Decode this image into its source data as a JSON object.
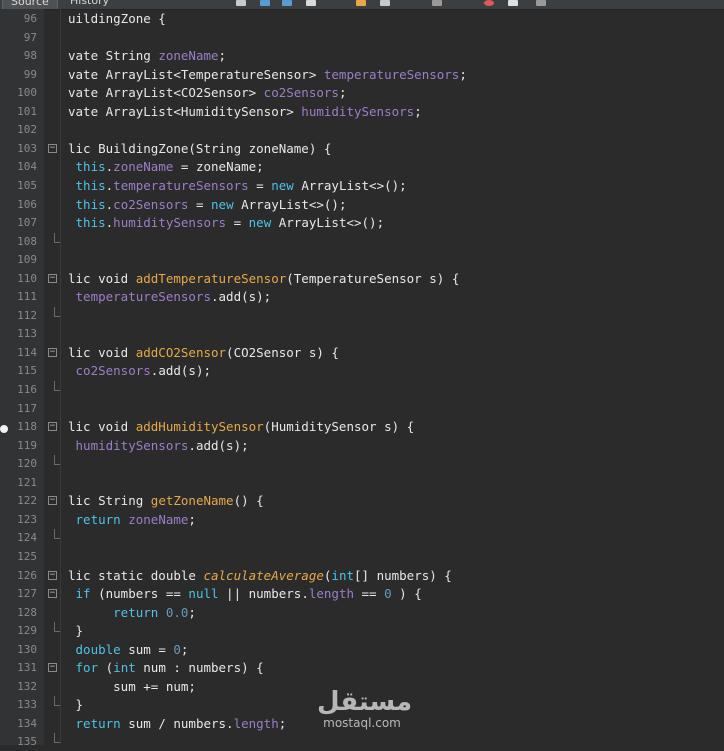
{
  "tabs": [
    {
      "label": "Source"
    },
    {
      "label": "History"
    }
  ],
  "toolbar_icons": [
    "search-icon",
    "back-icon",
    "forward-icon",
    "file-icon",
    "breakpoint-icon",
    "warning-icon",
    "comment-icon",
    "record-icon",
    "stop-icon"
  ],
  "lines": [
    {
      "n": "96",
      "fold": "",
      "segs": [
        [
          "",
          "uildingZone {"
        ]
      ]
    },
    {
      "n": "97",
      "fold": "",
      "segs": []
    },
    {
      "n": "98",
      "fold": "",
      "segs": [
        [
          "",
          "vate String "
        ],
        [
          "field",
          "zoneName"
        ],
        [
          "",
          ";"
        ]
      ]
    },
    {
      "n": "99",
      "fold": "",
      "segs": [
        [
          "",
          "vate ArrayList<TemperatureSensor> "
        ],
        [
          "field",
          "temperatureSensors"
        ],
        [
          "",
          ";"
        ]
      ]
    },
    {
      "n": "100",
      "fold": "",
      "segs": [
        [
          "",
          "vate ArrayList<CO2Sensor> "
        ],
        [
          "field",
          "co2Sensors"
        ],
        [
          "",
          ";"
        ]
      ]
    },
    {
      "n": "101",
      "fold": "",
      "segs": [
        [
          "",
          "vate ArrayList<HumiditySensor> "
        ],
        [
          "field",
          "humiditySensors"
        ],
        [
          "",
          ";"
        ]
      ]
    },
    {
      "n": "102",
      "fold": "",
      "segs": []
    },
    {
      "n": "103",
      "fold": "box",
      "segs": [
        [
          "",
          "lic BuildingZone(String zoneName) {"
        ]
      ]
    },
    {
      "n": "104",
      "fold": "",
      "segs": [
        [
          "kw",
          " this"
        ],
        [
          "",
          "."
        ],
        [
          "field",
          "zoneName"
        ],
        [
          "",
          " = zoneName;"
        ]
      ]
    },
    {
      "n": "105",
      "fold": "",
      "segs": [
        [
          "kw",
          " this"
        ],
        [
          "",
          "."
        ],
        [
          "field",
          "temperatureSensors"
        ],
        [
          "",
          " = "
        ],
        [
          "kw",
          "new"
        ],
        [
          "",
          " ArrayList<>();"
        ]
      ]
    },
    {
      "n": "106",
      "fold": "",
      "segs": [
        [
          "kw",
          " this"
        ],
        [
          "",
          "."
        ],
        [
          "field",
          "co2Sensors"
        ],
        [
          "",
          " = "
        ],
        [
          "kw",
          "new"
        ],
        [
          "",
          " ArrayList<>();"
        ]
      ]
    },
    {
      "n": "107",
      "fold": "",
      "segs": [
        [
          "kw",
          " this"
        ],
        [
          "",
          "."
        ],
        [
          "field",
          "humiditySensors"
        ],
        [
          "",
          " = "
        ],
        [
          "kw",
          "new"
        ],
        [
          "",
          " ArrayList<>();"
        ]
      ]
    },
    {
      "n": "108",
      "fold": "end",
      "segs": []
    },
    {
      "n": "109",
      "fold": "",
      "segs": []
    },
    {
      "n": "110",
      "fold": "box",
      "segs": [
        [
          "",
          "lic void "
        ],
        [
          "meth",
          "addTemperatureSensor"
        ],
        [
          "",
          "(TemperatureSensor s) {"
        ]
      ]
    },
    {
      "n": "111",
      "fold": "",
      "segs": [
        [
          "field",
          " temperatureSensors"
        ],
        [
          "",
          ".add(s);"
        ]
      ]
    },
    {
      "n": "112",
      "fold": "end",
      "segs": []
    },
    {
      "n": "113",
      "fold": "",
      "segs": []
    },
    {
      "n": "114",
      "fold": "box",
      "segs": [
        [
          "",
          "lic void "
        ],
        [
          "meth",
          "addCO2Sensor"
        ],
        [
          "",
          "(CO2Sensor s) {"
        ]
      ]
    },
    {
      "n": "115",
      "fold": "",
      "segs": [
        [
          "field",
          " co2Sensors"
        ],
        [
          "",
          ".add(s);"
        ]
      ]
    },
    {
      "n": "116",
      "fold": "end",
      "segs": []
    },
    {
      "n": "117",
      "fold": "",
      "segs": []
    },
    {
      "n": "118",
      "fold": "box",
      "segs": [
        [
          "",
          "lic void "
        ],
        [
          "meth",
          "addHumiditySensor"
        ],
        [
          "",
          "(HumiditySensor s) {"
        ]
      ]
    },
    {
      "n": "119",
      "fold": "",
      "segs": [
        [
          "field",
          " humiditySensors"
        ],
        [
          "",
          ".add(s);"
        ]
      ]
    },
    {
      "n": "120",
      "fold": "end",
      "segs": []
    },
    {
      "n": "121",
      "fold": "",
      "segs": []
    },
    {
      "n": "122",
      "fold": "box",
      "segs": [
        [
          "",
          "lic String "
        ],
        [
          "meth",
          "getZoneName"
        ],
        [
          "",
          "() {"
        ]
      ]
    },
    {
      "n": "123",
      "fold": "",
      "segs": [
        [
          "kw",
          " return"
        ],
        [
          "field",
          " zoneName"
        ],
        [
          "",
          ";"
        ]
      ]
    },
    {
      "n": "124",
      "fold": "end",
      "segs": []
    },
    {
      "n": "125",
      "fold": "",
      "segs": []
    },
    {
      "n": "126",
      "fold": "box",
      "segs": [
        [
          "",
          "lic static double "
        ],
        [
          "ital",
          "calculateAverage"
        ],
        [
          "",
          "("
        ],
        [
          "kw",
          "int"
        ],
        [
          "",
          "[] numbers) {"
        ]
      ]
    },
    {
      "n": "127",
      "fold": "box",
      "segs": [
        [
          "kw",
          " if"
        ],
        [
          "",
          " (numbers == "
        ],
        [
          "kw",
          "null"
        ],
        [
          "",
          " || numbers."
        ],
        [
          "field",
          "length"
        ],
        [
          "",
          " == "
        ],
        [
          "num",
          "0"
        ],
        [
          "",
          " ) {"
        ]
      ]
    },
    {
      "n": "128",
      "fold": "",
      "segs": [
        [
          "kw",
          "      return"
        ],
        [
          "num",
          " 0.0"
        ],
        [
          "",
          ";"
        ]
      ]
    },
    {
      "n": "129",
      "fold": "end",
      "segs": [
        [
          "",
          " }"
        ]
      ]
    },
    {
      "n": "130",
      "fold": "",
      "segs": [
        [
          "kw",
          " double"
        ],
        [
          "",
          " sum = "
        ],
        [
          "num",
          "0"
        ],
        [
          "",
          ";"
        ]
      ]
    },
    {
      "n": "131",
      "fold": "box",
      "segs": [
        [
          "kw",
          " for"
        ],
        [
          "",
          " ("
        ],
        [
          "kw",
          "int"
        ],
        [
          "",
          " num : numbers) {"
        ]
      ]
    },
    {
      "n": "132",
      "fold": "",
      "segs": [
        [
          "",
          "      sum += num;"
        ]
      ]
    },
    {
      "n": "133",
      "fold": "end",
      "segs": [
        [
          "",
          " }"
        ]
      ]
    },
    {
      "n": "134",
      "fold": "",
      "segs": [
        [
          "kw",
          " return"
        ],
        [
          "",
          " sum / numbers."
        ],
        [
          "field",
          "length"
        ],
        [
          "",
          ";"
        ]
      ]
    },
    {
      "n": "135",
      "fold": "end",
      "segs": []
    }
  ],
  "watermark": {
    "arabic": "مستقل",
    "latin": "mostaql.com"
  }
}
